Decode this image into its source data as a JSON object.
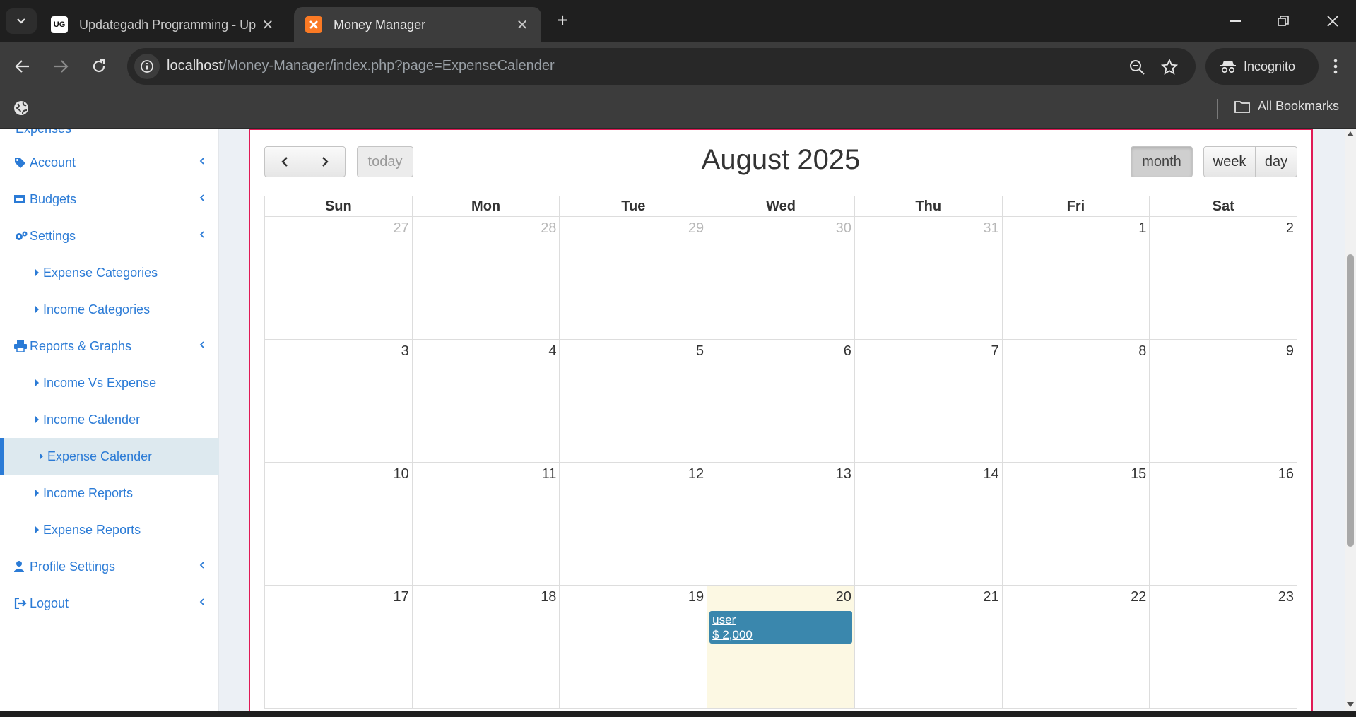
{
  "browser": {
    "tabs": [
      {
        "title": "Updategadh Programming - Up",
        "favicon": "UG",
        "active": false
      },
      {
        "title": "Money Manager",
        "favicon": "xampp-icon",
        "active": true
      }
    ],
    "url": {
      "host": "localhost",
      "path": "/Money-Manager/index.php?page=ExpenseCalender"
    },
    "profile_label": "Incognito",
    "bookmarks_label": "All Bookmarks"
  },
  "sidebar": {
    "partial_item": "Expenses",
    "items": [
      {
        "label": "Account",
        "icon": "tags-icon",
        "type": "group"
      },
      {
        "label": "Budgets",
        "icon": "money-icon",
        "type": "group"
      },
      {
        "label": "Settings",
        "icon": "cogs-icon",
        "type": "group"
      },
      {
        "label": "Expense Categories",
        "type": "sub"
      },
      {
        "label": "Income Categories",
        "type": "sub"
      },
      {
        "label": "Reports & Graphs",
        "icon": "print-icon",
        "type": "group"
      },
      {
        "label": "Income Vs Expense",
        "type": "sub"
      },
      {
        "label": "Income Calender",
        "type": "sub"
      },
      {
        "label": "Expense Calender",
        "type": "sub",
        "active": true
      },
      {
        "label": "Income Reports",
        "type": "sub"
      },
      {
        "label": "Expense Reports",
        "type": "sub"
      },
      {
        "label": "Profile Settings",
        "icon": "user-icon",
        "type": "group"
      },
      {
        "label": "Logout",
        "icon": "sign-out-icon",
        "type": "group"
      }
    ]
  },
  "calendar": {
    "title": "August 2025",
    "today_label": "today",
    "view_buttons": [
      "month",
      "week",
      "day"
    ],
    "active_view": "month",
    "weekdays": [
      "Sun",
      "Mon",
      "Tue",
      "Wed",
      "Thu",
      "Fri",
      "Sat"
    ],
    "weeks": [
      [
        {
          "d": "27",
          "o": true
        },
        {
          "d": "28",
          "o": true
        },
        {
          "d": "29",
          "o": true
        },
        {
          "d": "30",
          "o": true
        },
        {
          "d": "31",
          "o": true
        },
        {
          "d": "1"
        },
        {
          "d": "2"
        }
      ],
      [
        {
          "d": "3"
        },
        {
          "d": "4"
        },
        {
          "d": "5"
        },
        {
          "d": "6"
        },
        {
          "d": "7"
        },
        {
          "d": "8"
        },
        {
          "d": "9"
        }
      ],
      [
        {
          "d": "10"
        },
        {
          "d": "11"
        },
        {
          "d": "12"
        },
        {
          "d": "13"
        },
        {
          "d": "14"
        },
        {
          "d": "15"
        },
        {
          "d": "16"
        }
      ],
      [
        {
          "d": "17"
        },
        {
          "d": "18"
        },
        {
          "d": "19"
        },
        {
          "d": "20",
          "today": true
        },
        {
          "d": "21"
        },
        {
          "d": "22"
        },
        {
          "d": "23"
        }
      ]
    ],
    "events": [
      {
        "date": "20",
        "line1": "user",
        "line2": "$ 2,000"
      }
    ],
    "colors": {
      "event": "#3a87ad",
      "today_bg": "#fcf8e3",
      "box_accent": "#e01a55",
      "link": "#2b7bd6"
    }
  }
}
